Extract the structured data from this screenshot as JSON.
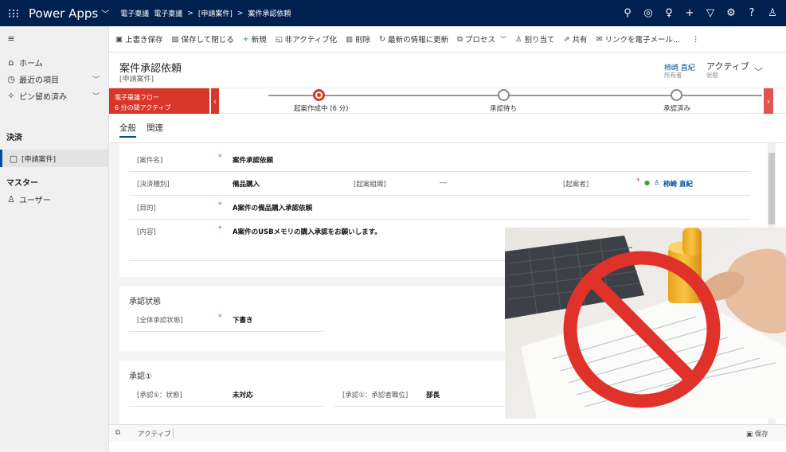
{
  "topbar": {
    "app_name": "Power Apps",
    "crumb_root": "電子稟議",
    "crumb_app": "電子稟議",
    "crumb_entity": "[申請案件]",
    "crumb_record": "案件承認依頼",
    "sep": ">"
  },
  "toolbar": {
    "save": "上書き保存",
    "save_close": "保存して閉じる",
    "new": "新規",
    "deactivate": "非アクティブ化",
    "delete": "削除",
    "refresh": "最新の情報に更新",
    "process": "プロセス",
    "assign": "割り当て",
    "share": "共有",
    "email_link": "リンクを電子メール..."
  },
  "sidebar": {
    "home": "ホーム",
    "recent": "最近の項目",
    "pinned": "ピン留め済み",
    "group1": "決済",
    "item1": "[申請案件]",
    "group2": "マスター",
    "item2": "ユーザー"
  },
  "header": {
    "title": "案件承認依頼",
    "subtitle": "[申請案件]",
    "owner_name": "柿崎 直紀",
    "owner_label": "所有者",
    "status_value": "アクティブ",
    "status_label": "状態"
  },
  "bpf": {
    "flow_name": "電子稟議フロー",
    "flow_status": "6 分の間アクティブ",
    "stage1": "起案作成中 (6 分)",
    "stage2": "承認待ち",
    "stage3": "承認済み"
  },
  "tabs": {
    "general": "全般",
    "related": "関連"
  },
  "form": {
    "case_name_label": "[案件名]",
    "case_name_value": "案件承認依頼",
    "type_label": "[決済種別]",
    "type_value": "備品購入",
    "org_label": "[起案組織]",
    "org_value": "---",
    "drafter_label": "[起案者]",
    "drafter_value": "柿崎 直紀",
    "purpose_label": "[目的]",
    "purpose_value": "A案件の備品購入承認依頼",
    "content_label": "[内容]",
    "content_value": "A案件のUSBメモリの購入承認をお願いします。",
    "sec2_title": "承認状態",
    "overall_label": "[全体承認状態]",
    "overall_value": "下書き",
    "sec3_title": "承認①",
    "a1_status_label": "[承認①：状態]",
    "a1_status_value": "未対応",
    "a1_position_label": "[承認①：承認者職位]",
    "a1_position_value": "部長"
  },
  "footer": {
    "status": "アクティブ",
    "save": "保存"
  },
  "colors": {
    "topbar": "#002050",
    "bpf_active": "#d9362a",
    "link": "#0050a0",
    "prohibit": "#e0322a"
  }
}
